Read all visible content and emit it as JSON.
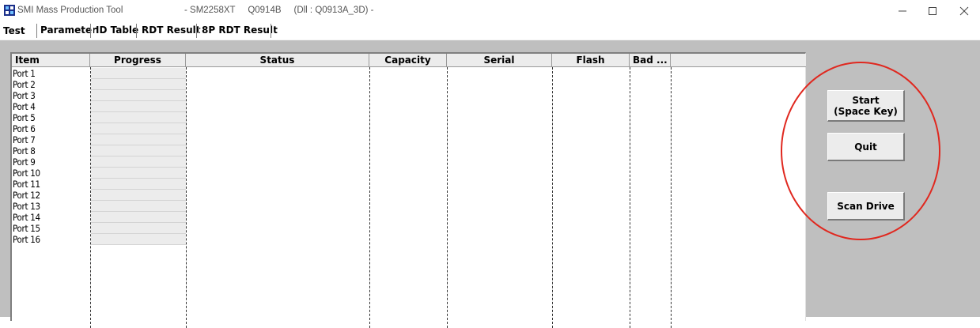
{
  "window": {
    "title": "SMI Mass Production Tool",
    "subtitle": "- SM2258XT     Q0914B     (Dll : Q0913A_3D) -"
  },
  "tabs": [
    {
      "label": "Test",
      "active": true
    },
    {
      "label": "Parameter",
      "active": false
    },
    {
      "label": "ID Table",
      "active": false
    },
    {
      "label": "RDT Result",
      "active": false
    },
    {
      "label": "8P RDT Result",
      "active": false
    }
  ],
  "list": {
    "columns": [
      "Item",
      "Progress",
      "Status",
      "Capacity",
      "Serial",
      "Flash",
      "Bad ..."
    ],
    "rows": [
      {
        "item": "Port 1"
      },
      {
        "item": "Port 2"
      },
      {
        "item": "Port 3"
      },
      {
        "item": "Port 4"
      },
      {
        "item": "Port 5"
      },
      {
        "item": "Port 6"
      },
      {
        "item": "Port 7"
      },
      {
        "item": "Port 8"
      },
      {
        "item": "Port 9"
      },
      {
        "item": "Port 10"
      },
      {
        "item": "Port 11"
      },
      {
        "item": "Port 12"
      },
      {
        "item": "Port 13"
      },
      {
        "item": "Port 14"
      },
      {
        "item": "Port 15"
      },
      {
        "item": "Port 16"
      }
    ]
  },
  "buttons": {
    "start_line1": "Start",
    "start_line2": "(Space Key)",
    "quit": "Quit",
    "scan": "Scan Drive"
  },
  "annotation": {
    "color": "#e0281f"
  },
  "icons": {
    "app": "smi-app-icon",
    "minimize": "minimize-icon",
    "maximize": "maximize-icon",
    "close": "close-icon"
  }
}
